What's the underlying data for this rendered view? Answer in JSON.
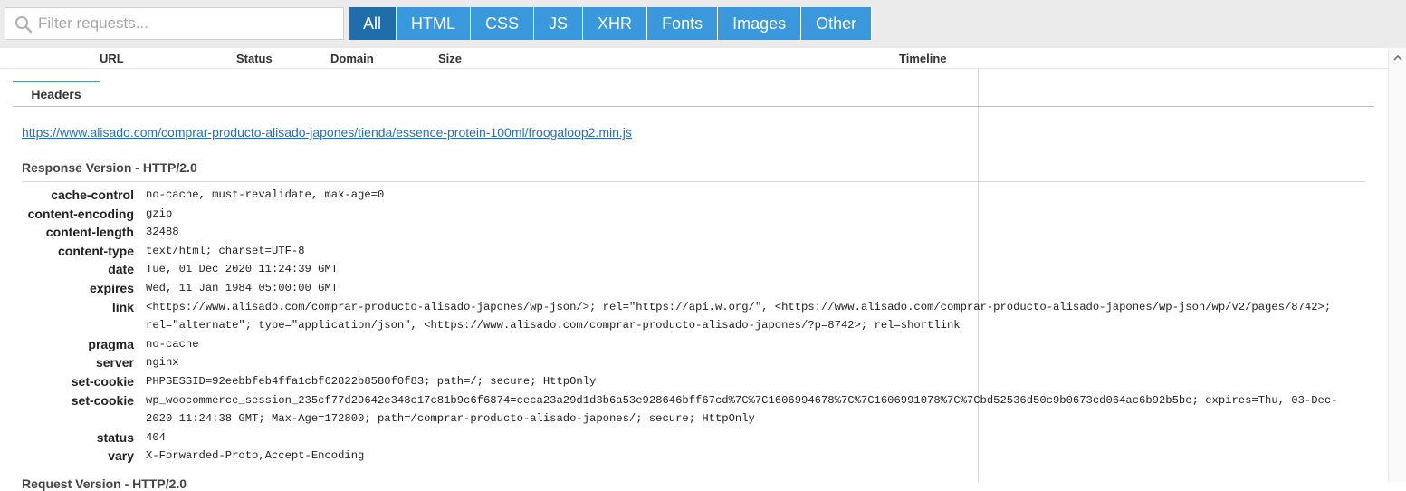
{
  "filter": {
    "placeholder": "Filter requests..."
  },
  "tabs": [
    {
      "label": "All",
      "active": true
    },
    {
      "label": "HTML"
    },
    {
      "label": "CSS"
    },
    {
      "label": "JS"
    },
    {
      "label": "XHR"
    },
    {
      "label": "Fonts"
    },
    {
      "label": "Images"
    },
    {
      "label": "Other"
    }
  ],
  "columns": {
    "url": "URL",
    "status": "Status",
    "domain": "Domain",
    "size": "Size",
    "timeline": "Timeline"
  },
  "detail": {
    "tab_headers": "Headers",
    "url": "https://www.alisado.com/comprar-producto-alisado-japones/tienda/essence-protein-100ml/froogaloop2.min.js",
    "response_version": "Response Version - HTTP/2.0",
    "headers": [
      {
        "name": "cache-control",
        "value": "no-cache, must-revalidate, max-age=0"
      },
      {
        "name": "content-encoding",
        "value": "gzip"
      },
      {
        "name": "content-length",
        "value": "32488"
      },
      {
        "name": "content-type",
        "value": "text/html; charset=UTF-8"
      },
      {
        "name": "date",
        "value": "Tue, 01 Dec 2020 11:24:39 GMT"
      },
      {
        "name": "expires",
        "value": "Wed, 11 Jan 1984 05:00:00 GMT"
      },
      {
        "name": "link",
        "value": "<https://www.alisado.com/comprar-producto-alisado-japones/wp-json/>; rel=\"https://api.w.org/\", <https://www.alisado.com/comprar-producto-alisado-japones/wp-json/wp/v2/pages/8742>; rel=\"alternate\"; type=\"application/json\", <https://www.alisado.com/comprar-producto-alisado-japones/?p=8742>; rel=shortlink"
      },
      {
        "name": "pragma",
        "value": "no-cache"
      },
      {
        "name": "server",
        "value": "nginx"
      },
      {
        "name": "set-cookie",
        "value": "PHPSESSID=92eebbfeb4ffa1cbf62822b8580f0f83; path=/; secure; HttpOnly"
      },
      {
        "name": "set-cookie",
        "value": "wp_woocommerce_session_235cf77d29642e348c17c81b9c6f6874=ceca23a29d1d3b6a53e928646bff67cd%7C%7C1606994678%7C%7C1606991078%7C%7Cbd52536d50c9b0673cd064ac6b92b5be; expires=Thu, 03-Dec-2020 11:24:38 GMT; Max-Age=172800; path=/comprar-producto-alisado-japones/; secure; HttpOnly"
      },
      {
        "name": "status",
        "value": "404"
      },
      {
        "name": "vary",
        "value": "X-Forwarded-Proto,Accept-Encoding"
      }
    ],
    "request_version": "Request Version - HTTP/2.0"
  }
}
